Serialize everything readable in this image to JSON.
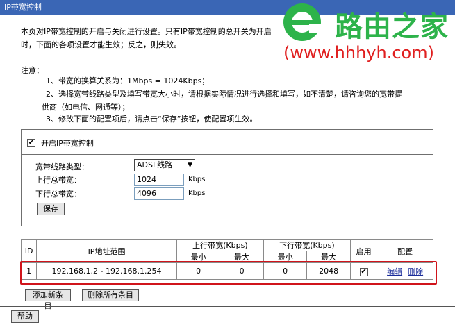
{
  "title": "IP带宽控制",
  "watermark": {
    "name": "路由之家",
    "url": "(www.hhhyh.com)"
  },
  "intro": "本页对IP带宽控制的开启与关闭进行设置。只有IP带宽控制的总开关为开启时，下面的各项设置才能生效；反之，则失效。",
  "notes": {
    "label": "注意：",
    "items": [
      "1、带宽的换算关系为：1Mbps = 1024Kbps；",
      "2、选择宽带线路类型及填写带宽大小时，请根据实际情况进行选择和填写，如不清楚，请咨询您的宽带提",
      "供商（如电信、网通等）；",
      "3、修改下面的配置项后，请点击“保存”按钮，使配置项生效。"
    ]
  },
  "settings": {
    "enable_label": "开启IP带宽控制",
    "enabled": true,
    "line_type_label": "宽带线路类型：",
    "line_type_value": "ADSL线路",
    "up_label": "上行总带宽：",
    "up_value": "1024",
    "down_label": "下行总带宽：",
    "down_value": "4096",
    "unit": "Kbps",
    "save_label": "保存"
  },
  "table": {
    "headers": {
      "id": "ID",
      "ip_range": "IP地址范围",
      "up": "上行带宽(Kbps)",
      "down": "下行带宽(Kbps)",
      "enable": "启用",
      "config": "配置",
      "min": "最小",
      "max": "最大"
    },
    "rows": [
      {
        "id": "1",
        "ip_range": "192.168.1.2 - 192.168.1.254",
        "up_min": "0",
        "up_max": "0",
        "down_min": "0",
        "down_max": "2048",
        "enabled": true,
        "edit": "编辑",
        "delete": "删除"
      }
    ]
  },
  "buttons": {
    "add": "添加新条目",
    "delete_all": "删除所有条目",
    "help": "帮助"
  },
  "colors": {
    "titlebar": "#3a66b5",
    "highlight": "#d0141b",
    "watermark_green": "#2db34a",
    "watermark_red": "#e01f1f"
  }
}
